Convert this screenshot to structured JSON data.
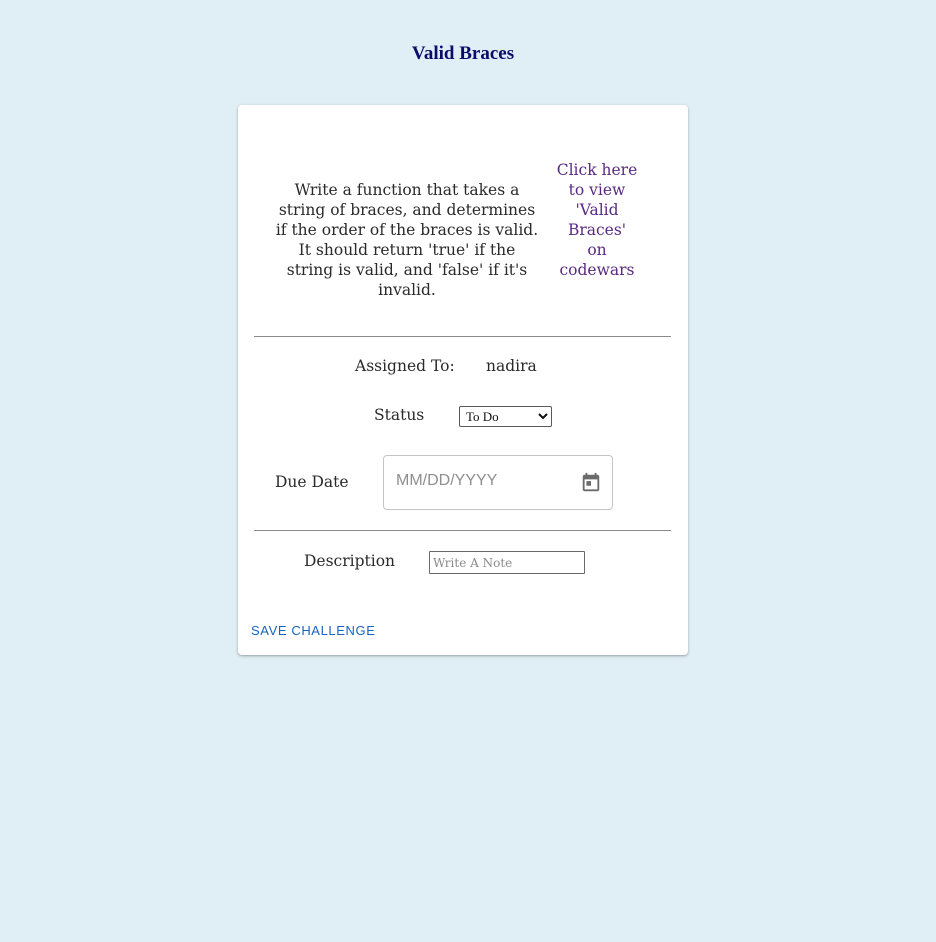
{
  "page": {
    "title": "Valid Braces"
  },
  "challenge": {
    "description": "Write a function that takes a string of braces, and determines if the order of the braces is valid. It should return 'true' if the string is valid, and 'false' if it's invalid.",
    "link_text": "Click here to view 'Valid Braces' on codewars"
  },
  "form": {
    "assigned_label": "Assigned To:",
    "assigned_value": "nadira",
    "status_label": "Status",
    "status_selected": "To Do",
    "due_label": "Due Date",
    "due_placeholder": "MM/DD/YYYY",
    "description_label": "Description",
    "description_placeholder": "Write A Note",
    "save_label": "SAVE CHALLENGE"
  },
  "icons": {
    "calendar": "calendar-icon",
    "select_arrow": "chevron-down-icon"
  },
  "colors": {
    "background": "#e0eff5",
    "title": "#0b0b6b",
    "link": "#5a2a82",
    "button": "#1565c0"
  }
}
